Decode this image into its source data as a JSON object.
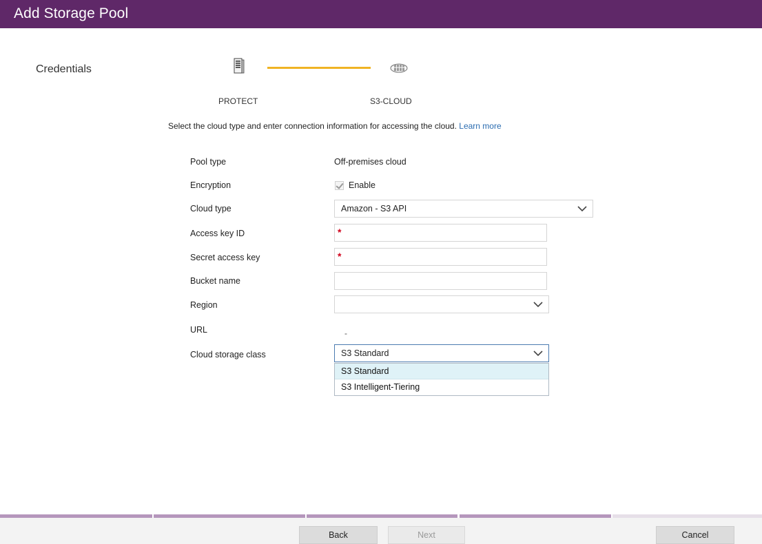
{
  "window": {
    "title": "Add Storage Pool"
  },
  "wizard": {
    "current_step": "Credentials",
    "progress": [
      {
        "label": "PROTECT",
        "icon": "server-icon",
        "state": "complete"
      },
      {
        "label": "S3-CLOUD",
        "icon": "cloud-storage-icon",
        "state": "current"
      }
    ],
    "accent_color": "#f0b323"
  },
  "intro": {
    "text": "Select the cloud type and enter connection information for accessing the cloud.",
    "link": "Learn more"
  },
  "form": {
    "pool_type": {
      "label": "Pool type",
      "value": "Off-premises cloud"
    },
    "encryption": {
      "label": "Encryption",
      "checkbox_label": "Enable",
      "checked": true,
      "disabled": true
    },
    "cloud_type": {
      "label": "Cloud type",
      "value": "Amazon - S3 API"
    },
    "access_key_id": {
      "label": "Access key ID",
      "value": "",
      "required_mark": "*"
    },
    "secret_access_key": {
      "label": "Secret access key",
      "value": "",
      "required_mark": "*"
    },
    "bucket_name": {
      "label": "Bucket name",
      "value": ""
    },
    "region": {
      "label": "Region",
      "value": ""
    },
    "url": {
      "label": "URL",
      "value": "-"
    },
    "cloud_storage_class": {
      "label": "Cloud storage class",
      "value": "S3 Standard",
      "expanded": true,
      "options": [
        "S3 Standard",
        "S3 Intelligent-Tiering"
      ]
    }
  },
  "footer": {
    "back_label": "Back",
    "next_label": "Next",
    "cancel_label": "Cancel",
    "next_disabled": true
  },
  "colors": {
    "title_bar": "#5f2868",
    "required": "#d0021b",
    "link": "#2b6cb0",
    "footer_progress": "#b596bc"
  }
}
